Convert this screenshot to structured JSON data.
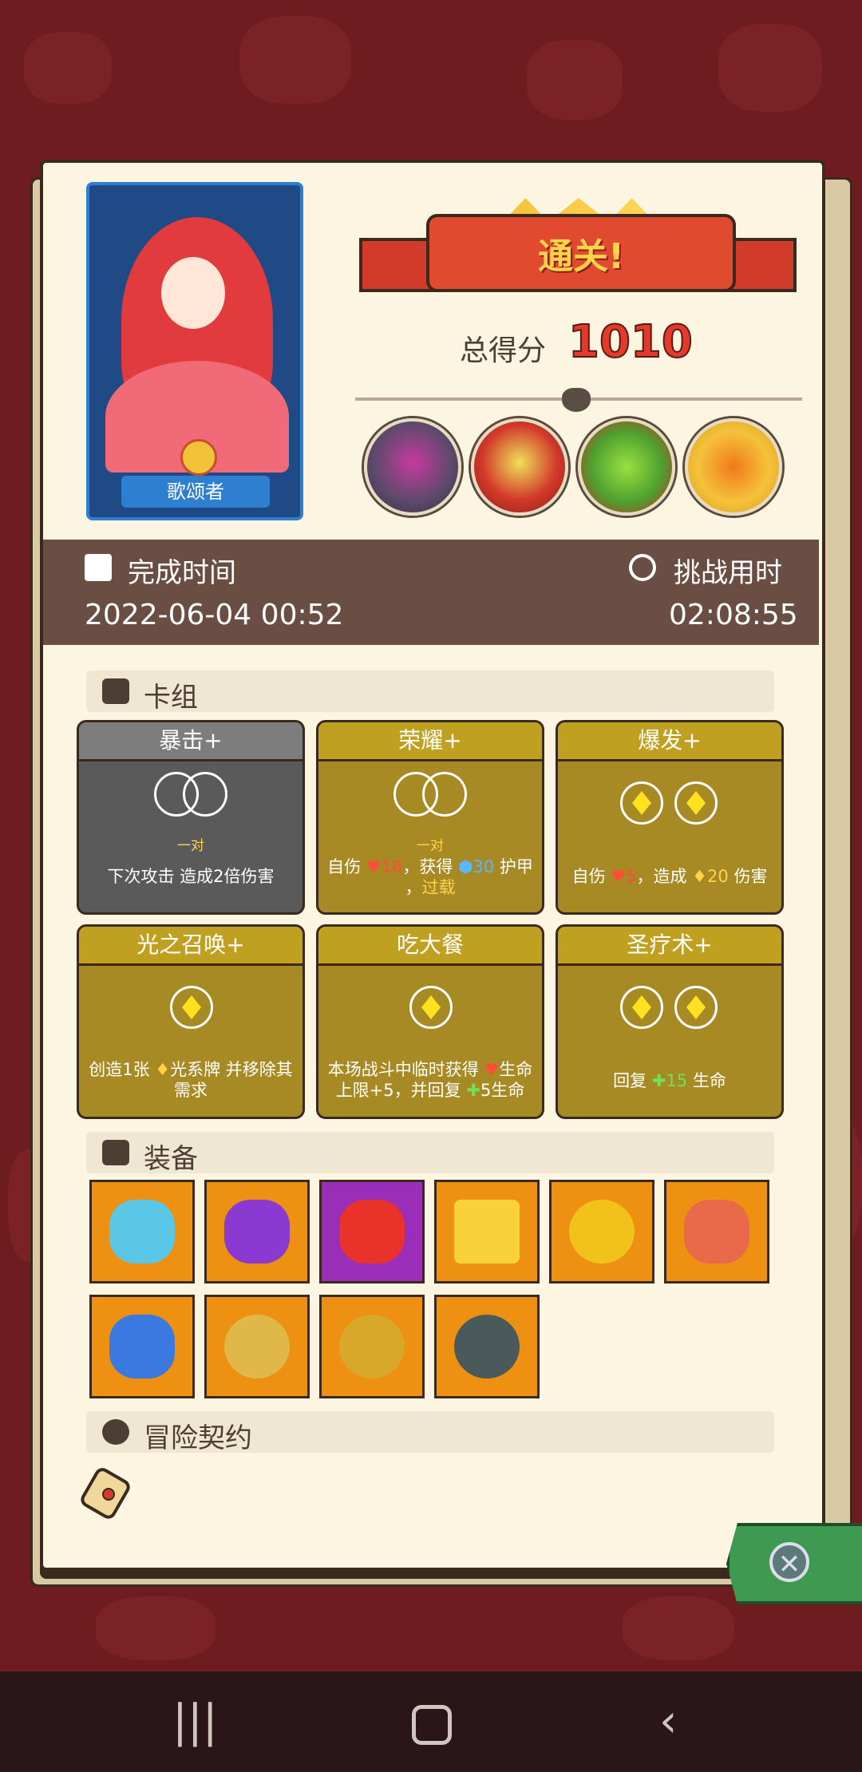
{
  "character": {
    "name": "歌颂者"
  },
  "result": {
    "banner": "通关!",
    "score_label": "总得分",
    "score_value": "1010"
  },
  "bosses": [
    "robot-boss-icon",
    "red-demon-boss-icon",
    "green-king-boss-icon",
    "pumpkin-sun-boss-icon"
  ],
  "time": {
    "finish_label": "完成时间",
    "finish_value": "2022-06-04 00:52",
    "challenge_label": "挑战用时",
    "challenge_value": "02:08:55"
  },
  "sections": {
    "deck": "卡组",
    "equipment": "装备",
    "contract": "冒险契约"
  },
  "cards": [
    {
      "title": "暴击+",
      "cost": "pair",
      "pair_label": "一对",
      "desc": "下次攻击 造成2倍伤害"
    },
    {
      "title": "荣耀+",
      "cost": "pair",
      "pair_label": "一对",
      "desc_parts": [
        "自伤",
        "18",
        "，获得",
        "30",
        "护甲",
        "，",
        "过载"
      ]
    },
    {
      "title": "爆发+",
      "cost": "2 gems",
      "desc_parts": [
        "自伤",
        "5",
        "，造成",
        "20",
        "伤害"
      ]
    },
    {
      "title": "光之召唤+",
      "cost": "1 gem",
      "desc_parts": [
        "创造1张",
        "光系牌 并移除其需求"
      ]
    },
    {
      "title": "吃大餐",
      "cost": "1 gem",
      "desc_parts": [
        "本场战斗中临时获得",
        "生命上限+5，并回复",
        "5生命"
      ]
    },
    {
      "title": "圣疗术+",
      "cost": "2 gems",
      "desc_parts": [
        "回复",
        "15",
        "生命"
      ]
    }
  ],
  "equipment": [
    {
      "icon": "ghost-slime-icon",
      "color": "#ee9112"
    },
    {
      "icon": "purple-hood-icon",
      "color": "#ee9112"
    },
    {
      "icon": "red-dragon-horn-icon",
      "color": "#9a2eb8"
    },
    {
      "icon": "gold-crown-icon",
      "color": "#ee9112"
    },
    {
      "icon": "gold-coin-icon",
      "color": "#ee9112"
    },
    {
      "icon": "meat-leg-icon",
      "color": "#ee9112"
    },
    {
      "icon": "blue-spiked-shield-icon",
      "color": "#ee9112"
    },
    {
      "icon": "lion-ring-icon",
      "color": "#ee9112"
    },
    {
      "icon": "red-gem-ring-icon",
      "color": "#ee9112"
    },
    {
      "icon": "lightning-ring-icon",
      "color": "#ee9112"
    }
  ],
  "colors": {
    "background": "#6e1c20",
    "paper": "#fbf5e1",
    "time_bar": "#6a4e44",
    "card_gold": "#a88a24",
    "card_gray": "#5a5a5a",
    "score": "#e43a2c"
  }
}
